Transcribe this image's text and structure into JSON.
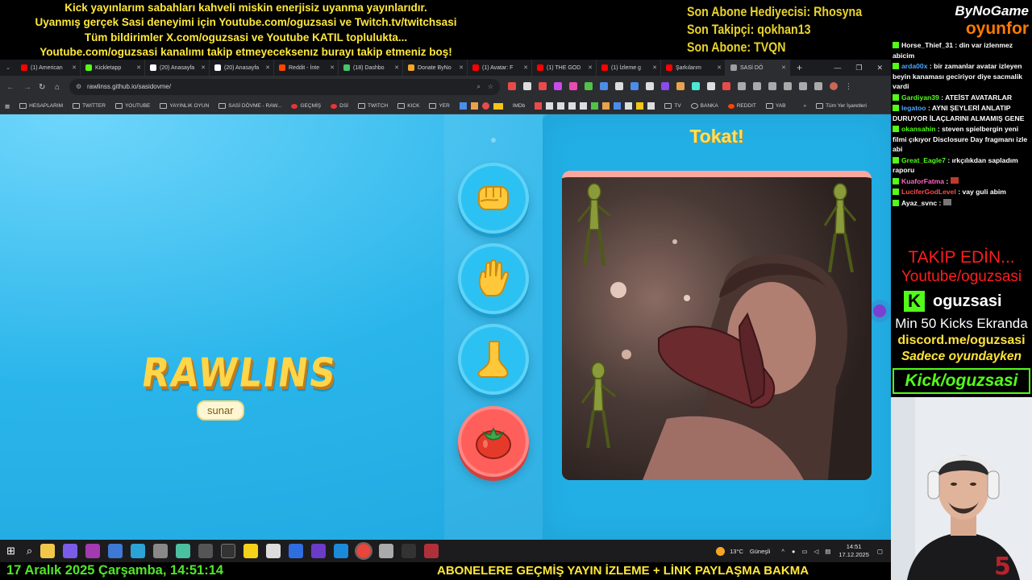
{
  "overlay": {
    "banner_lines": [
      "Kick yayınlarım sabahları kahveli miskin enerjisiz uyanma yayınlarıdır.",
      "Uyanmış gerçek Sasi deneyimi için Youtube.com/oguzsasi ve Twitch.tv/twitchsasi",
      "Tüm bildirimler X.com/oguzsasi ve Youtube KATIL toplulukta...",
      "Youtube.com/oguzsasi kanalımı takip etmeyeceksenız burayı takip etmeniz boş!"
    ],
    "stats": [
      "Son Abone Hediyecisi: Rhosyna",
      "Son Takipçi: qokhan13",
      "Son Abone: TVQN"
    ],
    "brand_top": "ByNoGame",
    "brand_bottom": "oyunfor",
    "bottom_date": "17 Aralık 2025 Çarşamba, 14:51:14",
    "bottom_ticker": "ABONELERE GEÇMİŞ YAYIN İZLEME + LİNK PAYLAŞMA BAKMA"
  },
  "chat": [
    {
      "user": "Horse_Thief_31",
      "text": ": din var izlenmez abicim",
      "color": "#ffffff"
    },
    {
      "user": "arda00x",
      "text": ": bir zamanlar avatar izleyen beyin kanaması geciriyor diye sacmalik vardi",
      "color": "#4aa8ff"
    },
    {
      "user": "Gardiyan39",
      "text": ": ATEİST AVATARLAR",
      "color": "#53fc18"
    },
    {
      "user": "legatoo",
      "text": ": AYNI ŞEYLERİ ANLATIP DURUYOR İLAÇLARINI ALMAMIŞ GENE",
      "color": "#4aa8ff"
    },
    {
      "user": "okansahin",
      "text": ": steven spielbergin yeni filmi çıkıyor Disclosure Day fragmanı izle abi",
      "color": "#53fc18"
    },
    {
      "user": "Great_Eagle7",
      "text": ": ırkçılıkdan sapladım raporu",
      "color": "#53fc18"
    },
    {
      "user": "KuaforFatma",
      "text": ":",
      "color": "#ff66c4"
    },
    {
      "user": "LuciferGodLevel",
      "text": ": vay guli abim",
      "color": "#ff4a4a"
    },
    {
      "user": "Ayaz_svnc",
      "text": ":",
      "color": "#ffffff"
    }
  ],
  "promo": {
    "follow": "TAKİP EDİN...",
    "youtube": "Youtube/oguzsasi",
    "kick_name": "oguzsasi",
    "min_kicks": "Min 50 Kicks Ekranda",
    "discord": "discord.me/oguzsasi",
    "only_game": "Sadece oyundayken",
    "kick_url": "Kick/oguzsasi"
  },
  "browser": {
    "tabs": [
      "(1) American",
      "Kickletapp",
      "(20) Anasayfa",
      "(20) Anasayfa",
      "Reddit - İnte",
      "(18) Dashbo",
      "Donate ByNo",
      "(1) Avatar: F",
      "(1) THE GOD",
      "(1) İzleme g",
      "Şarkılarım",
      "SASİ DÖ"
    ],
    "tab_colors": [
      "#ff0000",
      "#53fc18",
      "#ffffff",
      "#ffffff",
      "#ff4500",
      "#44c767",
      "#f5a623",
      "#ff0000",
      "#ff0000",
      "#ff0000",
      "#ff0000",
      "#9aa0a6"
    ],
    "url": "rawlinss.github.io/sasidovme/",
    "bookmarks": [
      "HESAPLARIM",
      "TWITTER",
      "YOUTUBE",
      "YAYINLIK OYUN",
      "SASİ DÖVME - RAW...",
      "GEÇMİŞ",
      "DSİ",
      "TWITCH",
      "KICK",
      "YER",
      "IMDb",
      "TV",
      "BANKA",
      "REDDIT",
      "YAB",
      "Tüm Yer İşaretleri"
    ]
  },
  "game": {
    "logo": "RAWLINS",
    "presents": "sunar",
    "title": "Tokat!",
    "actions": [
      "punch",
      "slap",
      "kick",
      "tomato"
    ]
  },
  "taskbar": {
    "weather": "13°C",
    "weather_label": "Güneşli",
    "time": "14:51",
    "date": "17.12.2025"
  }
}
